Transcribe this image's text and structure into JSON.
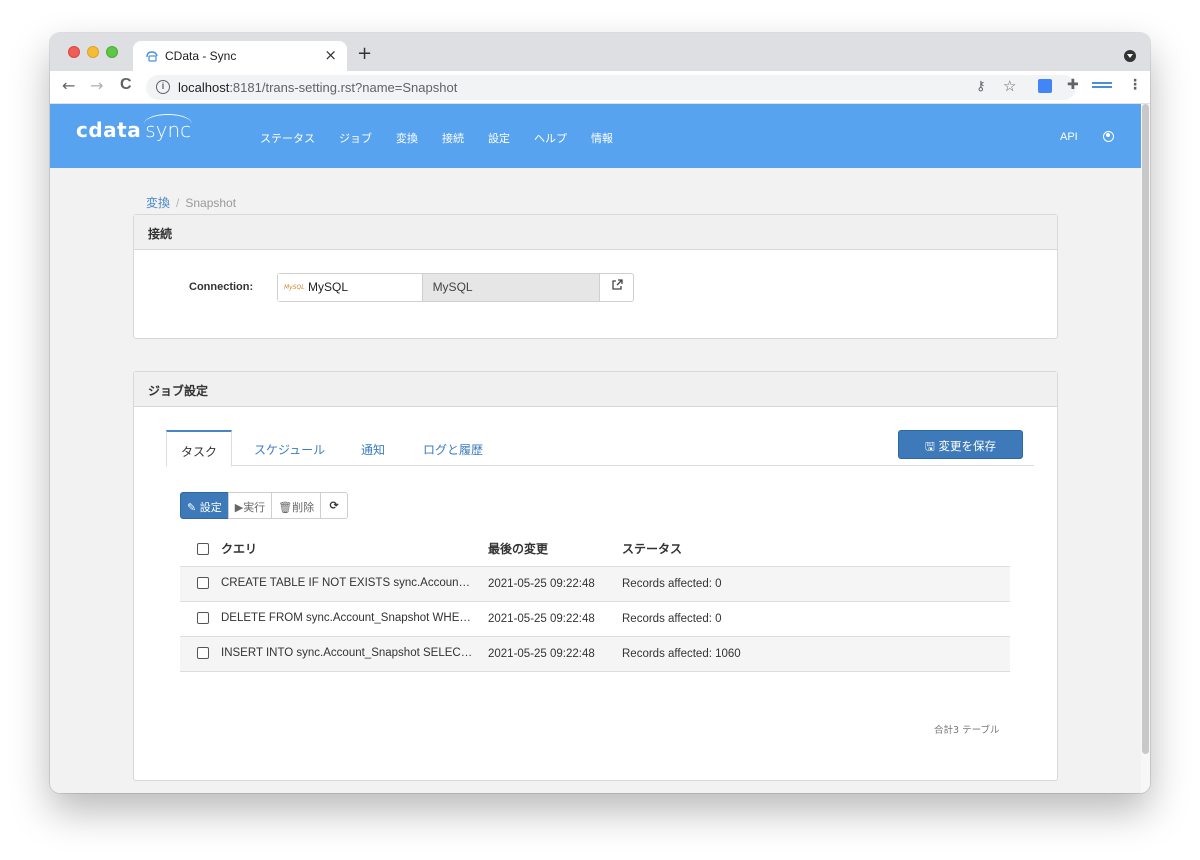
{
  "browser": {
    "tab_title": "CData - Sync",
    "tab_close": "×",
    "new_tab": "+",
    "url_host": "localhost",
    "url_rest": ":8181/trans-setting.rst?name=Snapshot",
    "back": "←",
    "forward": "→",
    "reload": "C"
  },
  "navbar": {
    "logo_cdata": "cdata",
    "logo_sync": "sync",
    "items": [
      "ステータス",
      "ジョブ",
      "変換",
      "接続",
      "設定",
      "ヘルプ",
      "情報"
    ],
    "api": "API"
  },
  "breadcrumb": {
    "parent": "変換",
    "separator": "/",
    "current": "Snapshot"
  },
  "connection_panel": {
    "heading": "接続",
    "label": "Connection:",
    "selected": "MySQL",
    "readonly_value": "MySQL",
    "logo_text": "MySQL"
  },
  "job_panel": {
    "heading": "ジョブ設定",
    "tabs": [
      "タスク",
      "スケジュール",
      "通知",
      "ログと履歴"
    ],
    "active_tab": "タスク",
    "save_button": "変更を保存",
    "toolbar": {
      "settings": "設定",
      "run": "実行",
      "delete": "削除"
    },
    "table": {
      "columns": [
        "クエリ",
        "最後の変更",
        "ステータス"
      ],
      "rows": [
        {
          "query": "CREATE TABLE IF NOT EXISTS sync.Accoun…",
          "modified": "2021-05-25 09:22:48",
          "status": "Records affected: 0"
        },
        {
          "query": "DELETE FROM sync.Account_Snapshot WHE…",
          "modified": "2021-05-25 09:22:48",
          "status": "Records affected: 0"
        },
        {
          "query": "INSERT INTO sync.Account_Snapshot SELEC…",
          "modified": "2021-05-25 09:22:48",
          "status": "Records affected: 1060"
        }
      ],
      "footer": "合計3 テーブル"
    }
  },
  "colors": {
    "navbar": "#58a3ef",
    "primary_button": "#3e7ab9",
    "link": "#3b7cc3"
  }
}
